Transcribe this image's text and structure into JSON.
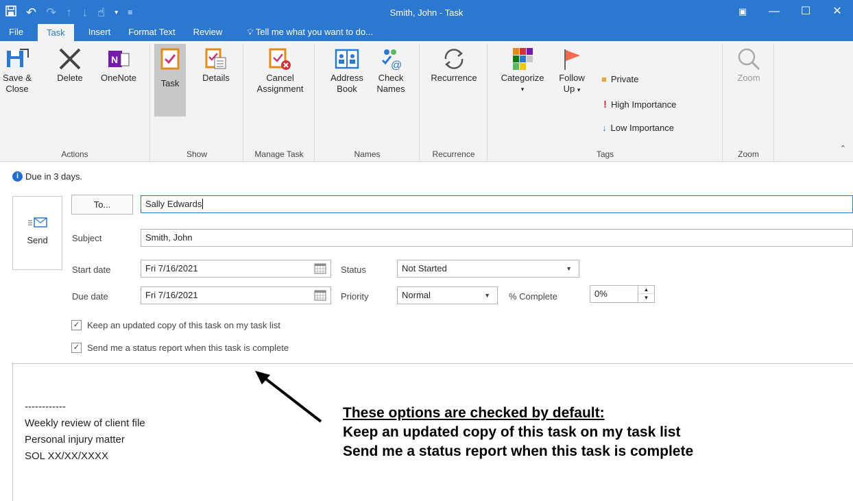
{
  "window": {
    "title": "Smith, John - Task",
    "qat_icons": [
      "save-icon",
      "undo-icon",
      "redo-icon",
      "up-arrow-icon",
      "down-arrow-icon",
      "touch-mode-icon",
      "qat-dropdown-icon",
      "customize-icon"
    ],
    "controls": [
      "ribbon-display-icon",
      "minimize-icon",
      "maximize-icon",
      "close-icon"
    ]
  },
  "menu": {
    "file": "File",
    "task": "Task",
    "insert": "Insert",
    "format_text": "Format Text",
    "review": "Review",
    "tell_me": "Tell me what you want to do..."
  },
  "ribbon": {
    "actions": {
      "label": "Actions",
      "save_close_1": "Save &",
      "save_close_2": "Close",
      "delete": "Delete",
      "onenote": "OneNote"
    },
    "show": {
      "label": "Show",
      "task": "Task",
      "details": "Details"
    },
    "manage": {
      "label": "Manage Task",
      "cancel_1": "Cancel",
      "cancel_2": "Assignment"
    },
    "names": {
      "label": "Names",
      "address_1": "Address",
      "address_2": "Book",
      "check_1": "Check",
      "check_2": "Names"
    },
    "recurrence": {
      "label": "Recurrence",
      "btn": "Recurrence"
    },
    "tags": {
      "label": "Tags",
      "categorize": "Categorize",
      "follow_1": "Follow",
      "follow_2": "Up",
      "private": "Private",
      "high": "High Importance",
      "low": "Low Importance"
    },
    "zoom": {
      "label": "Zoom",
      "btn": "Zoom"
    }
  },
  "info_bar": {
    "text": "Due in 3 days."
  },
  "form": {
    "send": "Send",
    "to_button": "To...",
    "to_value": "Sally Edwards",
    "subject_label": "Subject",
    "subject_value": "Smith, John",
    "start_label": "Start date",
    "start_value": "Fri 7/16/2021",
    "due_label": "Due date",
    "due_value": "Fri 7/16/2021",
    "status_label": "Status",
    "status_value": "Not Started",
    "priority_label": "Priority",
    "priority_value": "Normal",
    "complete_label": "% Complete",
    "complete_value": "0%",
    "keep_copy": "Keep an updated copy of this task on my task list",
    "status_report": "Send me a status report when this task is complete"
  },
  "notes": {
    "line1": "------------",
    "line2": "Weekly review of client file",
    "line3": "Personal injury matter",
    "line4": "SOL XX/XX/XXXX"
  },
  "annotation": {
    "heading": "These options are checked by default:",
    "line1": "Keep an updated copy of this task on my task list",
    "line2": "Send me a status report when this task is complete"
  },
  "colors": {
    "accent": "#2b78d1",
    "ribbon_bg": "#f3f3f3"
  }
}
